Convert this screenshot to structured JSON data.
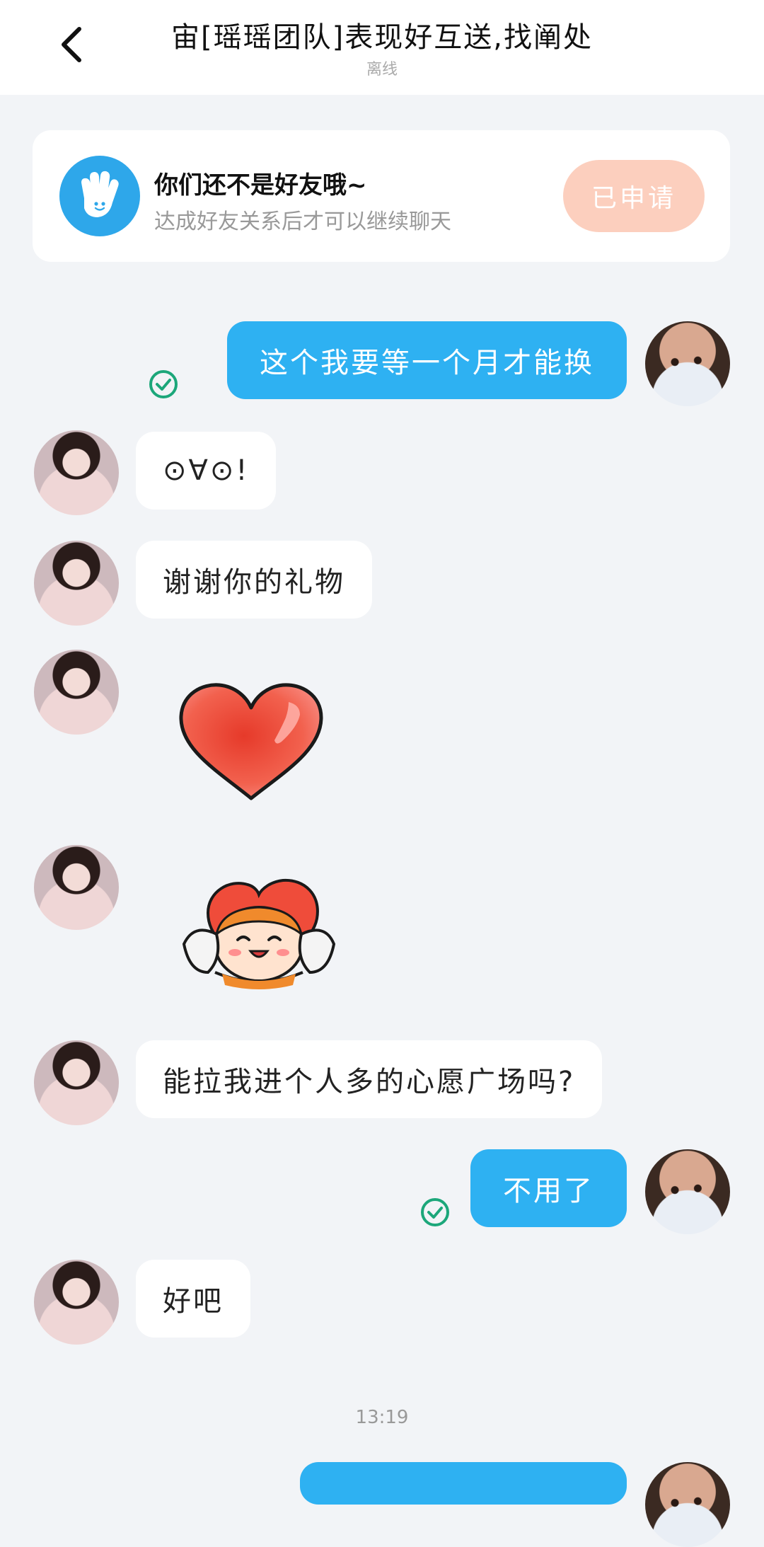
{
  "header": {
    "title": "宙[瑶瑶团队]表现好互送,找阐处",
    "status": "离线"
  },
  "friend_card": {
    "title": "你们还不是好友哦~",
    "subtitle": "达成好友关系后才可以继续聊天",
    "button_label": "已申请"
  },
  "messages": [
    {
      "from": "me",
      "type": "text",
      "text": "这个我要等一个月才能换",
      "delivered": true
    },
    {
      "from": "other",
      "type": "text",
      "text": "⊙∀⊙!"
    },
    {
      "from": "other",
      "type": "text",
      "text": "谢谢你的礼物"
    },
    {
      "from": "other",
      "type": "sticker",
      "sticker": "red-heart"
    },
    {
      "from": "other",
      "type": "sticker",
      "sticker": "cartoon-girl-holding-heart"
    },
    {
      "from": "other",
      "type": "text",
      "text": "能拉我进个人多的心愿广场吗?"
    },
    {
      "from": "me",
      "type": "text",
      "text": "不用了",
      "delivered": true
    },
    {
      "from": "other",
      "type": "text",
      "text": "好吧"
    }
  ],
  "timestamp": "13:19",
  "colors": {
    "accent_blue": "#2eb1f2",
    "applied_button": "#fccfbe",
    "check_green": "#1ca77a",
    "background": "#f2f4f7"
  }
}
